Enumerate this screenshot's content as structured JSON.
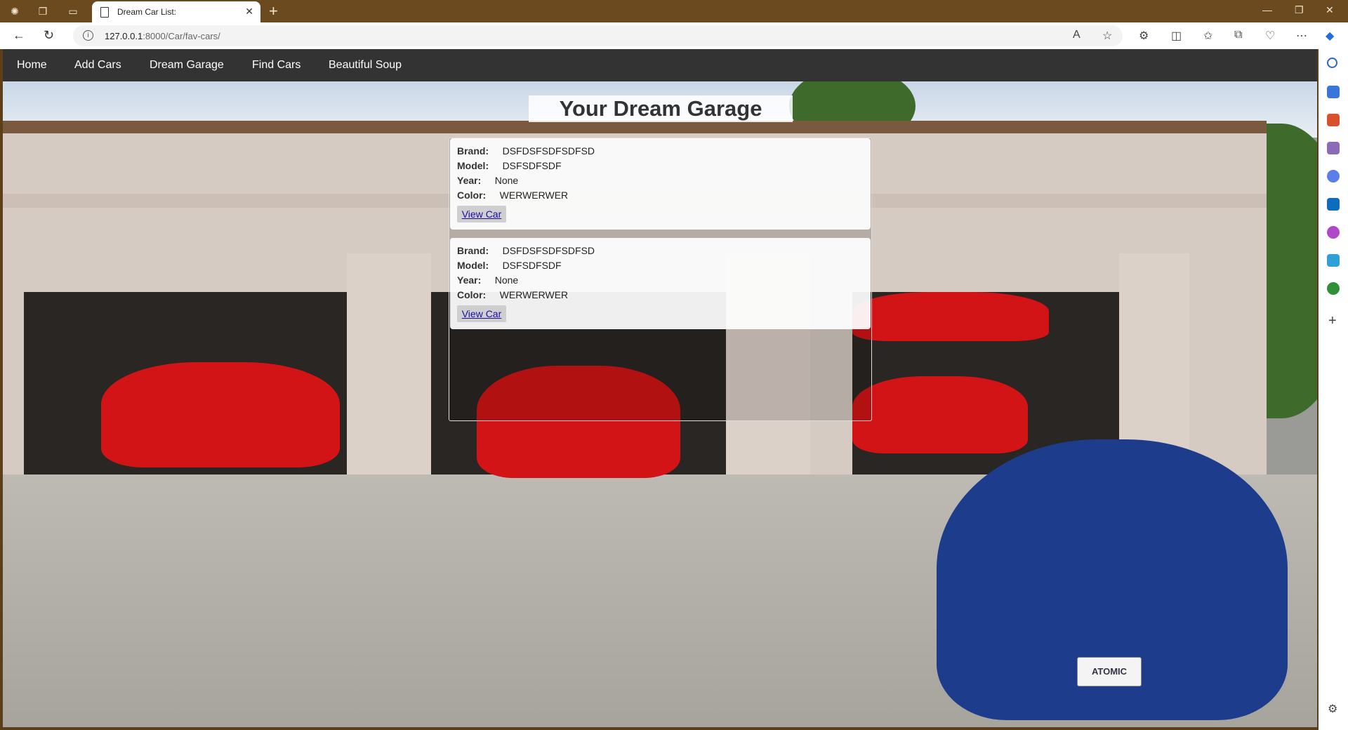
{
  "browser": {
    "tab_title": "Dream Car List:",
    "url_host": "127.0.0.1",
    "url_rest": ":8000/Car/fav-cars/"
  },
  "navbar": {
    "items": [
      {
        "label": "Home"
      },
      {
        "label": "Add Cars"
      },
      {
        "label": "Dream Garage"
      },
      {
        "label": "Find Cars"
      },
      {
        "label": "Beautiful Soup"
      }
    ]
  },
  "page": {
    "title": "Your Dream Garage",
    "field_labels": {
      "brand": "Brand:",
      "model": "Model:",
      "year": "Year:",
      "color": "Color:"
    },
    "cars": [
      {
        "brand": "DSFDSFSDFSDFSD",
        "model": "DSFSDFSDF",
        "year": "None",
        "color": "WERWERWER",
        "action": "View Car"
      },
      {
        "brand": "DSFDSFSDFSDFSD",
        "model": "DSFSDFSDF",
        "year": "None",
        "color": "WERWERWER",
        "action": "View Car"
      }
    ]
  },
  "background_plate": "ATOMIC",
  "colors": {
    "navbar_bg": "#333333",
    "titlebar_bg": "#6b4a1f",
    "link": "#1a0dab"
  },
  "icons": {
    "sidebar": [
      "search-icon",
      "tag-icon",
      "toolbox-icon",
      "chess-icon",
      "copilot-icon",
      "outlook-icon",
      "drop-icon",
      "send-icon",
      "tree-icon",
      "add-icon",
      "settings-icon"
    ]
  }
}
